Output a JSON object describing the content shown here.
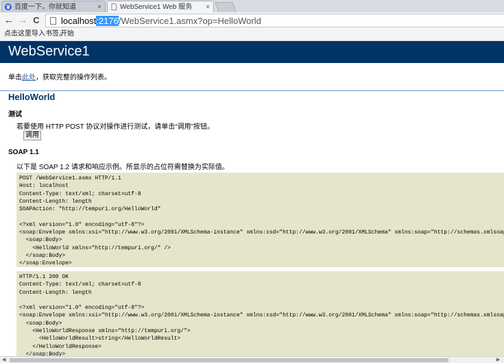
{
  "browser": {
    "tabs": [
      {
        "title": "百度一下，你就知道",
        "active": false,
        "icon": "paw-icon"
      },
      {
        "title": "WebService1 Web 服务",
        "active": true,
        "icon": "page-icon"
      }
    ],
    "close_glyph": "×",
    "nav": {
      "back": "←",
      "forward": "→",
      "reload": "C"
    },
    "url": {
      "host": "localhost",
      "port": ":2176",
      "path": "/WebService1.asmx?op=HelloWorld"
    },
    "bookmarks": {
      "import_prompt": "点击这里导入书签。",
      "start": "开始"
    }
  },
  "page": {
    "service_title": "WebService1",
    "intro_prefix": "单击",
    "intro_link": "此处",
    "intro_suffix": "，获取完整的操作列表。",
    "operation": "HelloWorld",
    "test_heading": "测试",
    "test_text": "若要使用 HTTP POST 协议对操作进行测试，请单击“调用”按钮。",
    "invoke_label": "调用",
    "soap_heading": "SOAP 1.1",
    "soap_text": "以下是 SOAP 1.2 请求和响应示例。所显示的占位符需替换为实际值。",
    "request_code": "POST /WebService1.asmx HTTP/1.1\nHost: localhost\nContent-Type: text/xml; charset=utf-8\nContent-Length: length\nSOAPAction: \"http://tempuri.org/HelloWorld\"\n\n<?xml version=\"1.0\" encoding=\"utf-8\"?>\n<soap:Envelope xmlns:xsi=\"http://www.w3.org/2001/XMLSchema-instance\" xmlns:xsd=\"http://www.w3.org/2001/XMLSchema\" xmlns:soap=\"http://schemas.xmlsoap.org/soap/envelope/\">\n  <soap:Body>\n    <HelloWorld xmlns=\"http://tempuri.org/\" />\n  </soap:Body>\n</soap:Envelope>",
    "response_code": "HTTP/1.1 200 OK\nContent-Type: text/xml; charset=utf-8\nContent-Length: length\n\n<?xml version=\"1.0\" encoding=\"utf-8\"?>\n<soap:Envelope xmlns:xsi=\"http://www.w3.org/2001/XMLSchema-instance\" xmlns:xsd=\"http://www.w3.org/2001/XMLSchema\" xmlns:soap=\"http://schemas.xmlsoap.org/soap/envelope/\">\n  <soap:Body>\n    <HelloWorldResponse xmlns=\"http://tempuri.org/\">\n      <HelloWorldResult>string</HelloWorldResult>\n    </HelloWorldResponse>\n  </soap:Body>\n</soap:Envelope>"
  },
  "colors": {
    "banner": "#003366",
    "code_background": "#e5e5cc",
    "link": "#336699",
    "url_selection": "#3399ff"
  }
}
